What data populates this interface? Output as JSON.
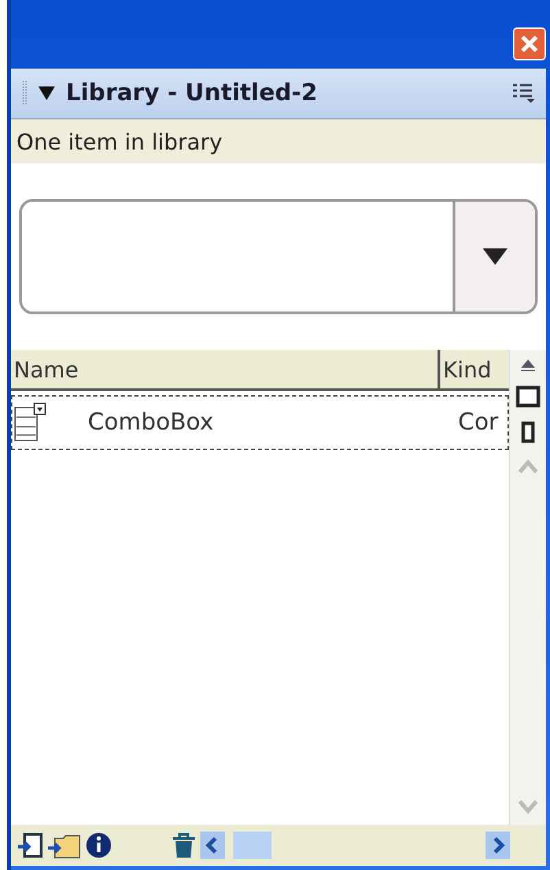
{
  "panel": {
    "title": "Library - Untitled-2",
    "expanded": true,
    "status": "One item in library"
  },
  "table": {
    "columns": [
      "Name",
      "Kind"
    ],
    "rows": [
      {
        "name": "ComboBox",
        "kind": "Cor",
        "selected": true
      }
    ]
  }
}
